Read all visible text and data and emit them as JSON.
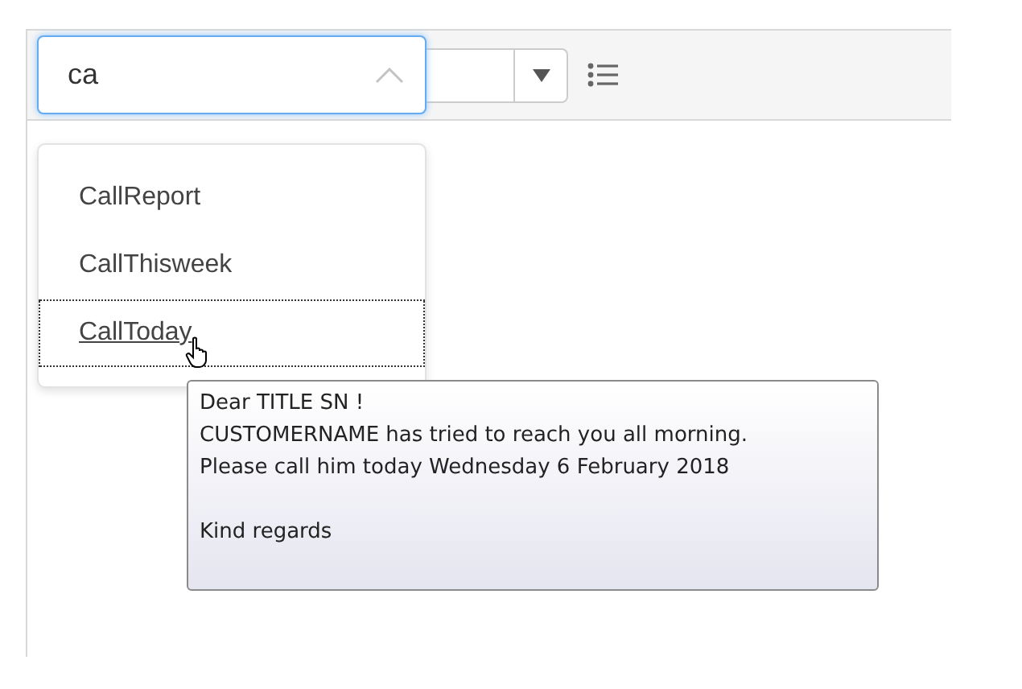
{
  "combobox": {
    "value": "ca",
    "expanded": true
  },
  "suggestions": [
    {
      "label": "CallReport",
      "selected": false
    },
    {
      "label": "CallThisweek",
      "selected": false
    },
    {
      "label": "CallToday",
      "selected": true
    }
  ],
  "tooltip": {
    "paragraphs": [
      [
        "Dear TITLE SN !",
        "CUSTOMERNAME has tried to reach you all morning.",
        "Please call him today Wednesday 6 February 2018"
      ],
      [
        "Kind regards"
      ]
    ]
  }
}
